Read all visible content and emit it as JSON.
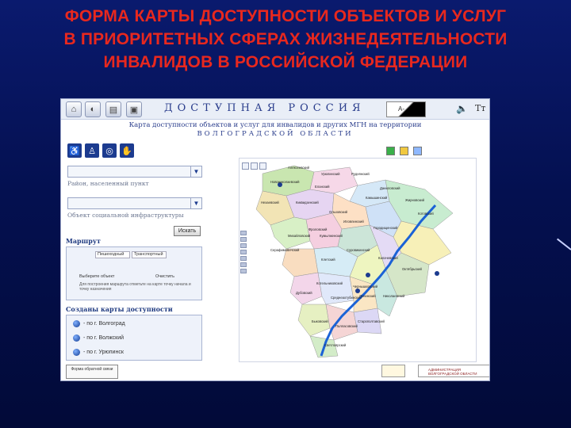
{
  "slide": {
    "title_line1": "ФОРМА КАРТЫ ДОСТУПНОСТИ ОБЪЕКТОВ И УСЛУГ",
    "title_line2": "В ПРИОРИТЕТНЫХ СФЕРАХ ЖИЗНЕДЕЯТЕЛЬНОСТИ",
    "title_line3": "ИНВАЛИДОВ В РОССИЙСКОЙ ФЕДЕРАЦИИ",
    "title_color": "#e8281e"
  },
  "site": {
    "title": "ДОСТУПНАЯ РОССИЯ",
    "subtitle_line1": "Карта доступности объектов и услуг для инвалидов и других МГН на территории",
    "subtitle_line2": "ВОЛГОГРАДСКОЙ ОБЛАСТИ",
    "contrast_label": "А-",
    "font_toggle": "Тт",
    "nav_icons": [
      "home-icon",
      "back-icon",
      "print-icon",
      "settings-icon"
    ]
  },
  "left_panel": {
    "category_icons": [
      "wheelchair-icon",
      "walking-person-icon",
      "hearing-icon",
      "sign-language-icon"
    ],
    "district_caption": "Район, населенный пункт",
    "infra_caption": "Объект социальной инфраструктуры",
    "search_button": "Искать",
    "route_heading": "Маршрут",
    "route_tabs": [
      "Пешеходный",
      "Транспортный"
    ],
    "route_from": "Выберите объект",
    "route_clear": "Очистить",
    "route_note": "Для построения маршрута отметьте на карте точку начала и точку назначения",
    "maps_heading": "Созданы карты доступности",
    "map_links": [
      "- по г. Волгоград",
      "- по г. Волжский",
      "- по г. Урюпинск"
    ],
    "bottom_link": "Форма обратной связи"
  },
  "map": {
    "regions": [
      "Алексеевский",
      "Урюпинский",
      "Новониколаевский",
      "Нехаевский",
      "Киквидзенский",
      "Еланский",
      "Руднянский",
      "Даниловский",
      "Жирновский",
      "Котовский",
      "Камышинский",
      "Ольховский",
      "Иловлинский",
      "Городищенский",
      "Фроловский",
      "Михайловский",
      "Кумылженский",
      "Серафимовичский",
      "Клетский",
      "Суровикинский",
      "Калачевский",
      "Октябрьский",
      "Котельниковский",
      "Чернышковский",
      "Дубовский",
      "Среднеахтубинский",
      "Ленинский",
      "Николаевский",
      "Быковский",
      "Палласовский",
      "Старополтавский",
      "Светлоярский"
    ],
    "river_color": "#1b62d6"
  },
  "footer": {
    "legend_text": "АДМИНИСТРАЦИЯ ВОЛГОГРАДСКОЙ ОБЛАСТИ"
  }
}
